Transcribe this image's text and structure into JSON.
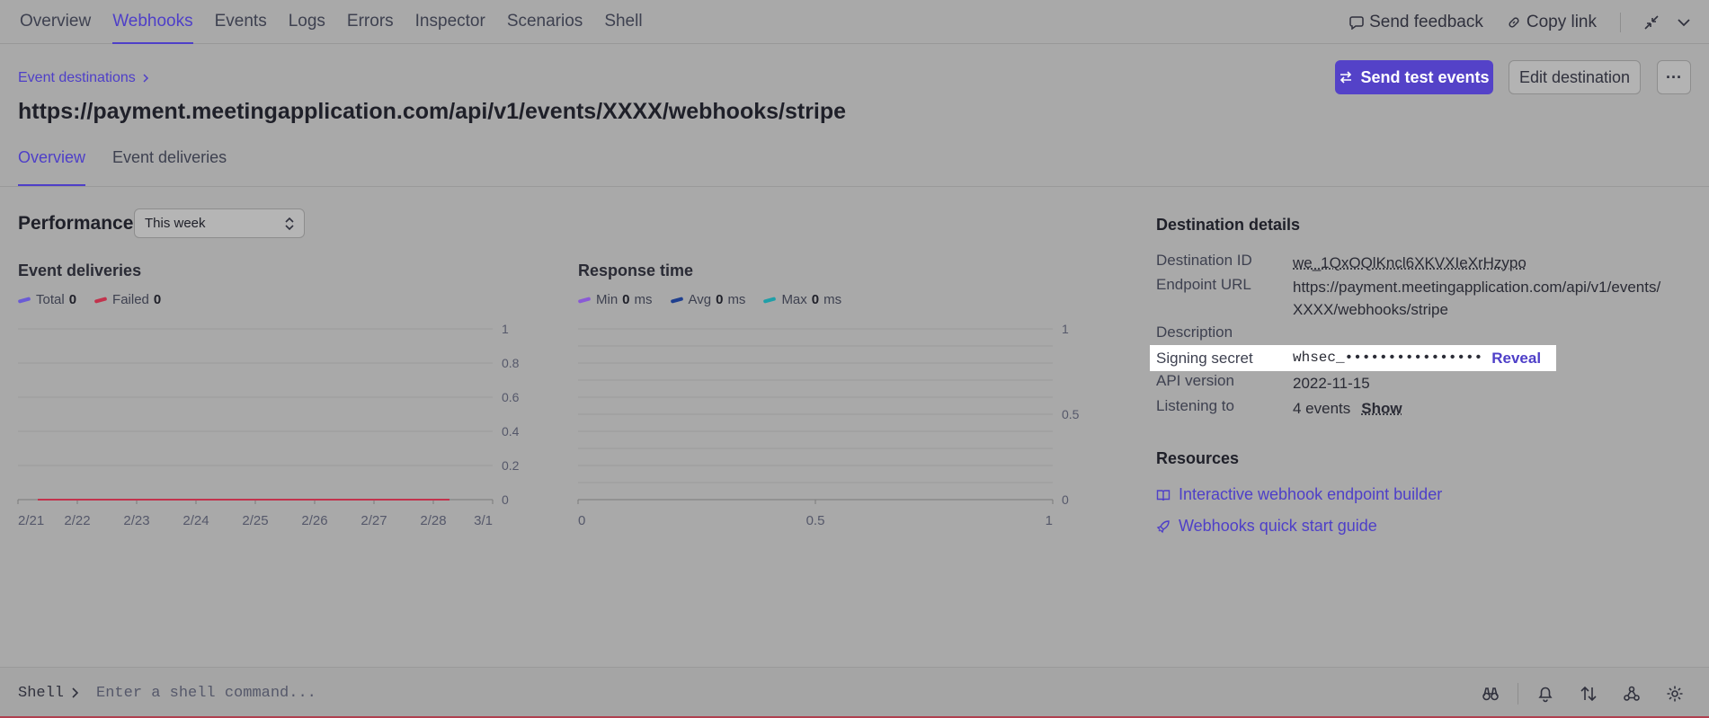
{
  "topnav": {
    "tabs": [
      "Overview",
      "Webhooks",
      "Events",
      "Logs",
      "Errors",
      "Inspector",
      "Scenarios",
      "Shell"
    ],
    "active_tab": "Webhooks",
    "send_feedback": "Send feedback",
    "copy_link": "Copy link"
  },
  "header": {
    "breadcrumb": "Event destinations",
    "title": "https://payment.meetingapplication.com/api/v1/events/XXXX/webhooks/stripe",
    "send_test_label": "Send test events",
    "edit_label": "Edit destination",
    "more_label": "···"
  },
  "subtabs": [
    "Overview",
    "Event deliveries"
  ],
  "performance": {
    "title": "Performance",
    "range": "This week"
  },
  "chart_data": [
    {
      "type": "line",
      "title": "Event deliveries",
      "categories": [
        "2/21",
        "2/22",
        "2/23",
        "2/24",
        "2/25",
        "2/26",
        "2/27",
        "2/28",
        "3/1"
      ],
      "ylim": [
        0,
        1
      ],
      "yticks": [
        "1",
        "0.8",
        "0.6",
        "0.4",
        "0.2",
        "0"
      ],
      "series": [
        {
          "name": "Total",
          "total": "0",
          "color": "#6a5bd6",
          "values": [
            0,
            0,
            0,
            0,
            0,
            0,
            0,
            0
          ]
        },
        {
          "name": "Failed",
          "total": "0",
          "color": "#c2334d",
          "values": [
            0,
            0,
            0,
            0,
            0,
            0,
            0,
            0
          ]
        }
      ]
    },
    {
      "type": "line",
      "title": "Response time",
      "xticks": [
        "0",
        "0.5",
        "1"
      ],
      "yticks": [
        "1",
        "0.5",
        "0"
      ],
      "xlim": [
        0,
        1
      ],
      "ylim": [
        0,
        1
      ],
      "series": [
        {
          "name": "Min",
          "value": "0",
          "unit": "ms",
          "color": "#8a5ad6",
          "values": []
        },
        {
          "name": "Avg",
          "value": "0",
          "unit": "ms",
          "color": "#1f3f8f",
          "values": []
        },
        {
          "name": "Max",
          "value": "0",
          "unit": "ms",
          "color": "#1f9fa8",
          "values": []
        }
      ]
    }
  ],
  "details": {
    "title": "Destination details",
    "destination_id_label": "Destination ID",
    "destination_id": "we_1QxOQlKncl6XKVXIeXrHzypo",
    "endpoint_label": "Endpoint URL",
    "endpoint_line1": "https://payment.meetingapplication.com/api/v1/events/",
    "endpoint_line2": "XXXX/webhooks/stripe",
    "description_label": "Description",
    "secret_label": "Signing secret",
    "secret_value": "whsec_••••••••••••••••",
    "reveal": "Reveal",
    "api_label": "API version",
    "api_version": "2022-11-15",
    "listening_label": "Listening to",
    "listening_value": "4 events",
    "show": "Show"
  },
  "resources": {
    "title": "Resources",
    "builder": "Interactive webhook endpoint builder",
    "guide": "Webhooks quick start guide"
  },
  "shell": {
    "label": "Shell",
    "placeholder": "Enter a shell command..."
  }
}
